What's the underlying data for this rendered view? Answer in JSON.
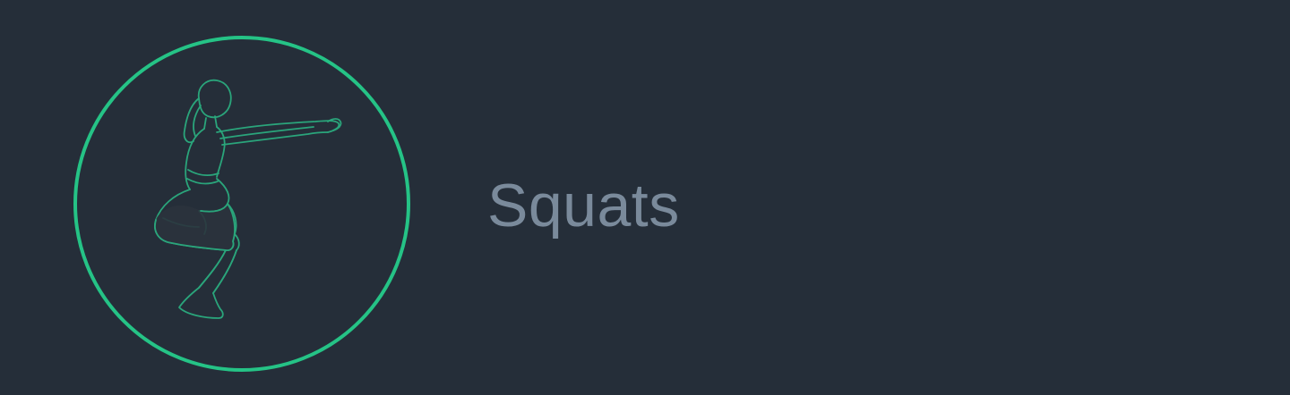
{
  "exercise": {
    "name": "Squats",
    "icon": "squat-figure-icon"
  },
  "colors": {
    "background": "#252e39",
    "accent_ring": "#25c386",
    "figure_stroke": "#2aa57b",
    "label": "#7a8a9b"
  }
}
